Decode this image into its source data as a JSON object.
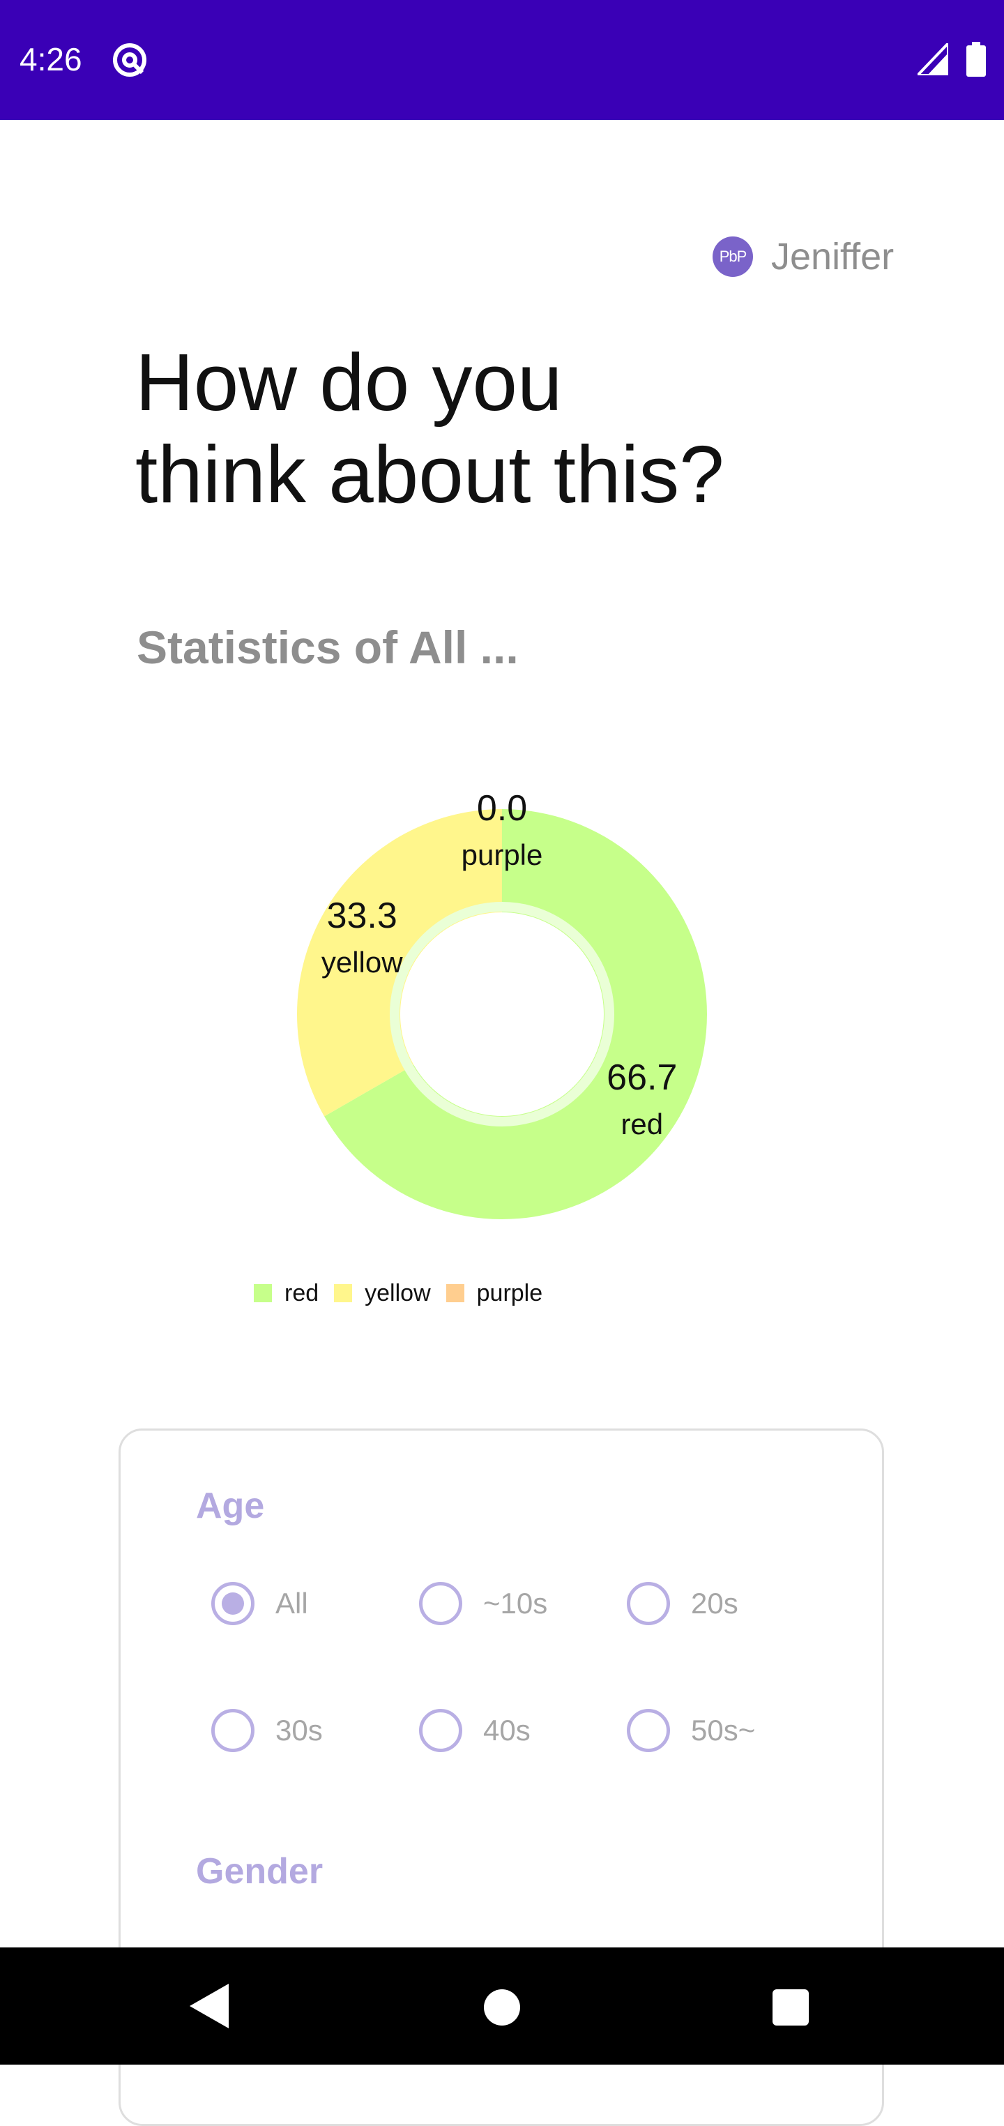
{
  "status_bar": {
    "time": "4:26",
    "app_icon": "at-sign-icon",
    "signal_icon": "signal-icon",
    "battery_icon": "battery-icon"
  },
  "header": {
    "avatar_text": "PbP",
    "user_name": "Jeniffer"
  },
  "title": "How do you\nthink about this?",
  "stats_heading": "Statistics of  All ...",
  "colors": {
    "status_bar": "#3a00b6",
    "accent": "#b9afe4",
    "red_slice": "#c6ff8a",
    "yellow_slice": "#fff68c",
    "purple_slice": "#ffce8f"
  },
  "chart_data": {
    "type": "pie",
    "variant": "donut",
    "categories": [
      "red",
      "yellow",
      "purple"
    ],
    "values": [
      66.7,
      33.3,
      0.0
    ],
    "value_labels": [
      "66.7",
      "33.3",
      "0.0"
    ],
    "colors": [
      "#c6ff8a",
      "#fff68c",
      "#ffce8f"
    ],
    "legend": [
      "red",
      "yellow",
      "purple"
    ],
    "legend_position": "bottom-left",
    "title": ""
  },
  "filters": {
    "age_label": "Age",
    "age_options": [
      {
        "label": "All",
        "checked": true
      },
      {
        "label": "~10s",
        "checked": false
      },
      {
        "label": "20s",
        "checked": false
      },
      {
        "label": "30s",
        "checked": false
      },
      {
        "label": "40s",
        "checked": false
      },
      {
        "label": "50s~",
        "checked": false
      }
    ],
    "gender_label": "Gender"
  },
  "nav": {
    "back_icon": "back-triangle-icon",
    "home_icon": "home-circle-icon",
    "recent_icon": "recent-square-icon"
  }
}
